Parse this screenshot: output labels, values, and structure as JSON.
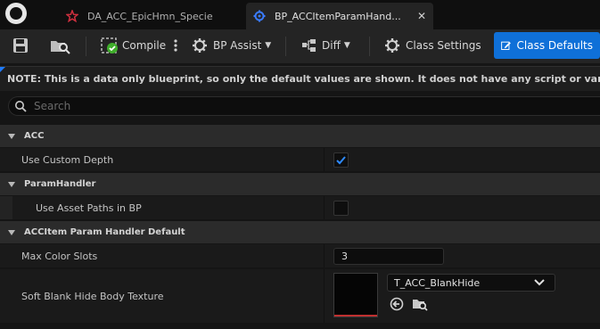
{
  "tabs": [
    {
      "label": "DA_ACC_EpicHmn_Specie",
      "icon": "data-asset-icon",
      "active": false
    },
    {
      "label": "BP_ACCItemParamHand...",
      "icon": "blueprint-icon",
      "active": true
    }
  ],
  "toolbar": {
    "save_icon": "save-icon",
    "browse_icon": "browse-icon",
    "compile_label": "Compile",
    "bp_assist_label": "BP Assist",
    "diff_label": "Diff",
    "class_settings_label": "Class Settings",
    "class_defaults_label": "Class Defaults"
  },
  "note": "NOTE: This is a data only blueprint, so only the default values are shown.  It does not have any script or variables.  If",
  "search": {
    "placeholder": "Search"
  },
  "details": {
    "cat_acc": "ACC",
    "use_custom_depth": {
      "label": "Use Custom Depth",
      "checked": true
    },
    "cat_paramhandler": "ParamHandler",
    "use_asset_paths": {
      "label": "Use Asset Paths in BP",
      "checked": false
    },
    "cat_default": "ACCItem Param Handler Default",
    "max_color_slots": {
      "label": "Max Color Slots",
      "value": "3"
    },
    "soft_blank": {
      "label": "Soft Blank Hide Body Texture",
      "value": "T_ACC_BlankHide"
    }
  },
  "colors": {
    "accent": "#0f70d8",
    "check": "#2e8bff"
  }
}
